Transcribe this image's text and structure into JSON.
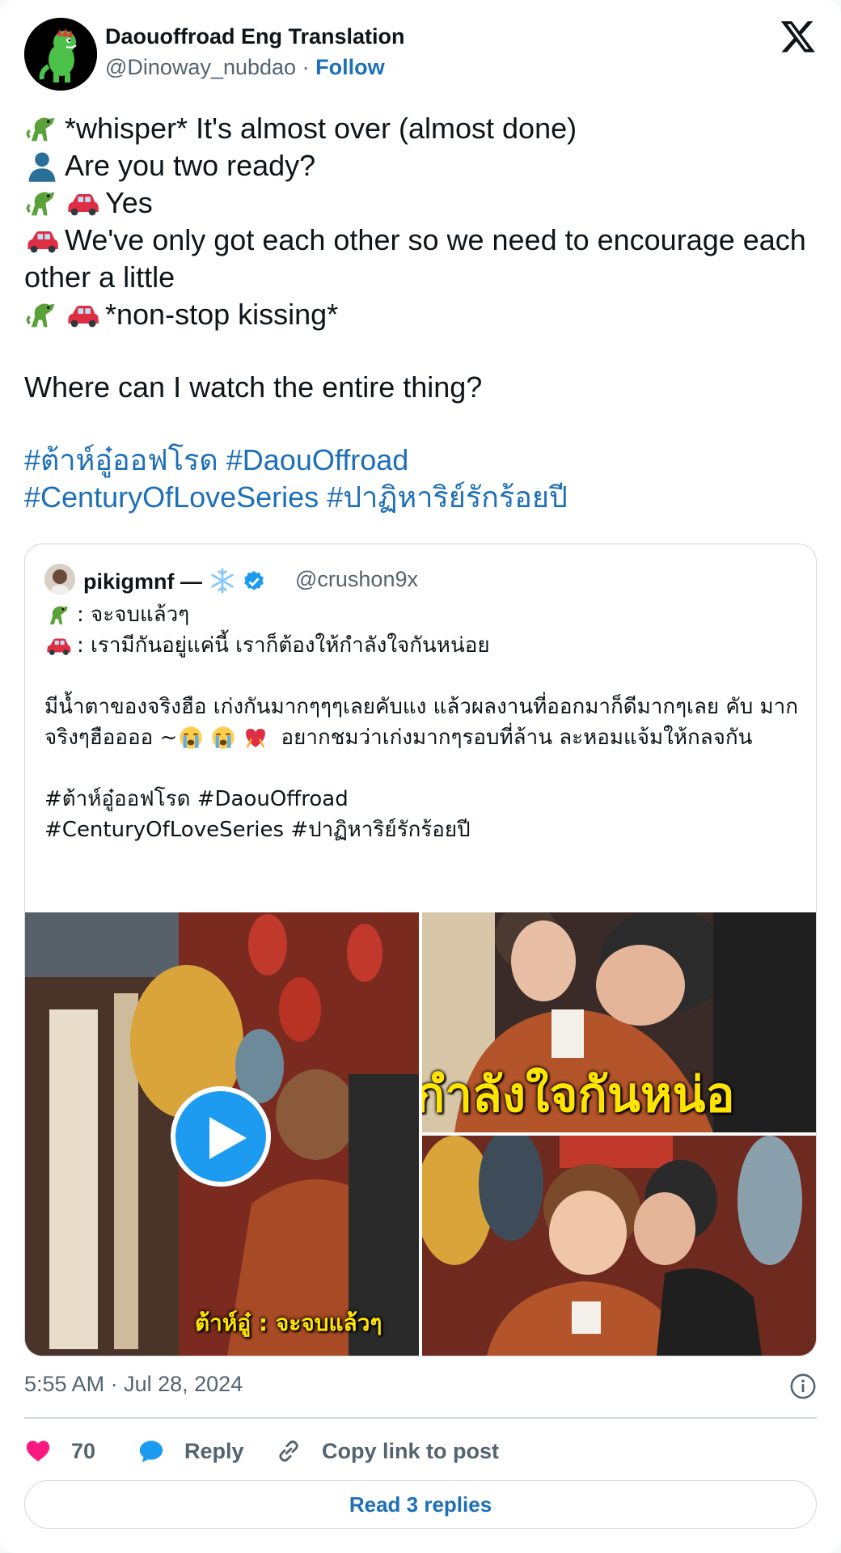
{
  "author": {
    "display_name": "Daouoffroad Eng Translation",
    "handle": "@Dinoway_nubdao",
    "separator": "·",
    "follow_label": "Follow"
  },
  "tweet": {
    "lines": [
      "*whisper* It's almost over (almost done)",
      "Are you two ready?",
      "Yes",
      "We've only got each other so we need to encourage each other a little",
      "*non-stop kissing*",
      "Where can I watch the entire thing?"
    ],
    "hashtags_line1": [
      "#ต้าห์อู๋ออฟโรด",
      "#DaouOffroad"
    ],
    "hashtags_line2": [
      "#CenturyOfLoveSeries",
      "#ปาฏิหาริย์รักร้อยปี"
    ]
  },
  "quoted": {
    "display_name": "pikigmnf —",
    "handle": "@crushon9x",
    "line1": ": จะจบแล้วๆ",
    "line2": ": เรามีกันอยู่แค่นี้ เราก็ต้องให้กำลังใจกันหน่อย",
    "para1": "มีน้ำตาของจริงฮือ เก่งกันมากๆๆๆเลยคับแง แล้วผลงานที่ออกมาก็ดีมากๆเลย คับ มากจริงๆฮืออออ ~",
    "para1_tail": " อยากชมว่าเก่งมากๆรอบที่ล้าน ละหอมแจ้มให้กลจกัน",
    "hashtags_line1": "#ต้าห์อู๋ออฟโรด #DaouOffroad",
    "hashtags_line2": "#CenturyOfLoveSeries #ปาฏิหาริย์รักร้อยปี",
    "media": {
      "subtitle_left": "ต้าห์อู๋ : จะจบแล้วๆ",
      "subtitle_right": "กำลังใจกันหน่อ"
    }
  },
  "meta": {
    "time": "5:55 AM",
    "separator": "·",
    "date": "Jul 28, 2024"
  },
  "actions": {
    "like_count": "70",
    "reply_label": "Reply",
    "copy_label": "Copy link to post"
  },
  "read_replies_label": "Read 3 replies",
  "colors": {
    "link": "#1d6fb8",
    "heart": "#f91880",
    "reply_bubble": "#1d9bf0",
    "verified": "#1d9bf0"
  }
}
